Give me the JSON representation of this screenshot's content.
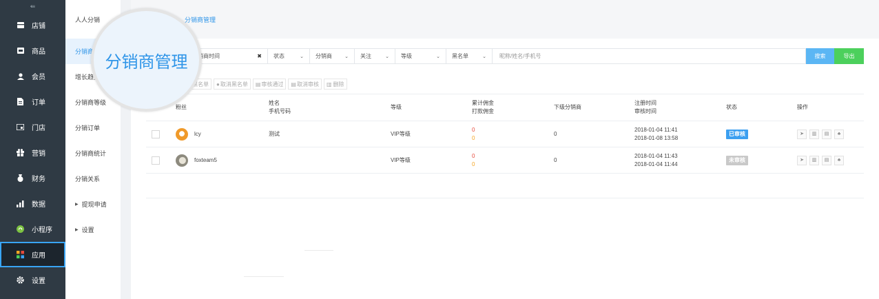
{
  "sidebar": {
    "toggle": "⇚",
    "items": [
      {
        "label": "店铺",
        "icon": "shop-icon"
      },
      {
        "label": "商品",
        "icon": "goods-icon"
      },
      {
        "label": "会员",
        "icon": "member-icon"
      },
      {
        "label": "订单",
        "icon": "order-icon"
      },
      {
        "label": "门店",
        "icon": "store-icon"
      },
      {
        "label": "营销",
        "icon": "gift-icon"
      },
      {
        "label": "财务",
        "icon": "finance-icon"
      },
      {
        "label": "数据",
        "icon": "chart-icon"
      },
      {
        "label": "小程序",
        "icon": "miniprogram-icon"
      },
      {
        "label": "应用",
        "icon": "apps-icon"
      },
      {
        "label": "设置",
        "icon": "gear-icon"
      }
    ],
    "active_index": 9
  },
  "subnav": {
    "title": "人人分销",
    "items": [
      {
        "label": "分销商管理",
        "type": "link"
      },
      {
        "label": "增长趋势",
        "type": "link"
      },
      {
        "label": "分销商等级",
        "type": "link"
      },
      {
        "label": "分销订单",
        "type": "link"
      },
      {
        "label": "分销商统计",
        "type": "link"
      },
      {
        "label": "分销关系",
        "type": "link"
      },
      {
        "label": "提现申请",
        "type": "group"
      },
      {
        "label": "设置",
        "type": "group"
      }
    ],
    "active_index": 0
  },
  "breadcrumb": "分销商管理",
  "magnifier_text": "分销商管理",
  "filters": {
    "date_placeholder": "分销商时间",
    "clear_symbol": "✖",
    "selects": [
      "状态",
      "分销商",
      "关注",
      "等级",
      "黑名单"
    ],
    "search_placeholder": "昵称/姓名/手机号",
    "search_btn": "搜索",
    "export_btn": "导出"
  },
  "toolbar": [
    "黑名单",
    "取消黑名单",
    "审核通过",
    "取消审核",
    "删除"
  ],
  "table": {
    "headers": {
      "fans": "粉丝",
      "name": "姓名",
      "phone": "手机号码",
      "level": "等级",
      "commission_total": "累计佣金",
      "commission_paid": "打款佣金",
      "downline": "下级分销商",
      "reg_time": "注册时间",
      "audit_time": "审核时间",
      "status": "状态",
      "ops": "操作"
    },
    "rows": [
      {
        "nick": "lcy",
        "name": "测试",
        "level": "VIP等级",
        "commission_total": "0",
        "commission_paid": "0",
        "downline": "0",
        "reg_time": "2018-01-04 11:41",
        "audit_time": "2018-01-08 13:58",
        "status": "已审核",
        "status_color": "#3c9ff0",
        "avatar_color": "#f09a2a"
      },
      {
        "nick": "foxteam5",
        "name": "",
        "level": "VIP等级",
        "commission_total": "0",
        "commission_paid": "0",
        "downline": "0",
        "reg_time": "2018-01-04 11:43",
        "audit_time": "2018-01-04 11:44",
        "status": "未审核",
        "status_color": "#c9c9c9",
        "avatar_color": "#8d8a7e"
      }
    ]
  },
  "colors": {
    "accent": "#2f95e8",
    "search_btn": "#5bb6f4",
    "export_btn": "#4cd05c",
    "red": "#e64a3b",
    "orange": "#f5a623"
  }
}
